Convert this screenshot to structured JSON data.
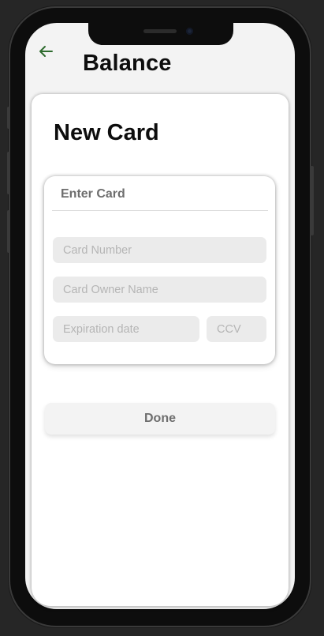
{
  "header": {
    "title": "Balance",
    "back_icon": "arrow-left-icon",
    "accent_color": "#2e6b2e"
  },
  "new_card": {
    "title": "New Card",
    "form": {
      "heading": "Enter Card",
      "card_number": {
        "value": "",
        "placeholder": "Card Number"
      },
      "owner_name": {
        "value": "",
        "placeholder": "Card Owner Name"
      },
      "expiration": {
        "value": "",
        "placeholder": "Expiration date"
      },
      "ccv": {
        "value": "",
        "placeholder": "CCV"
      }
    },
    "done_label": "Done"
  }
}
